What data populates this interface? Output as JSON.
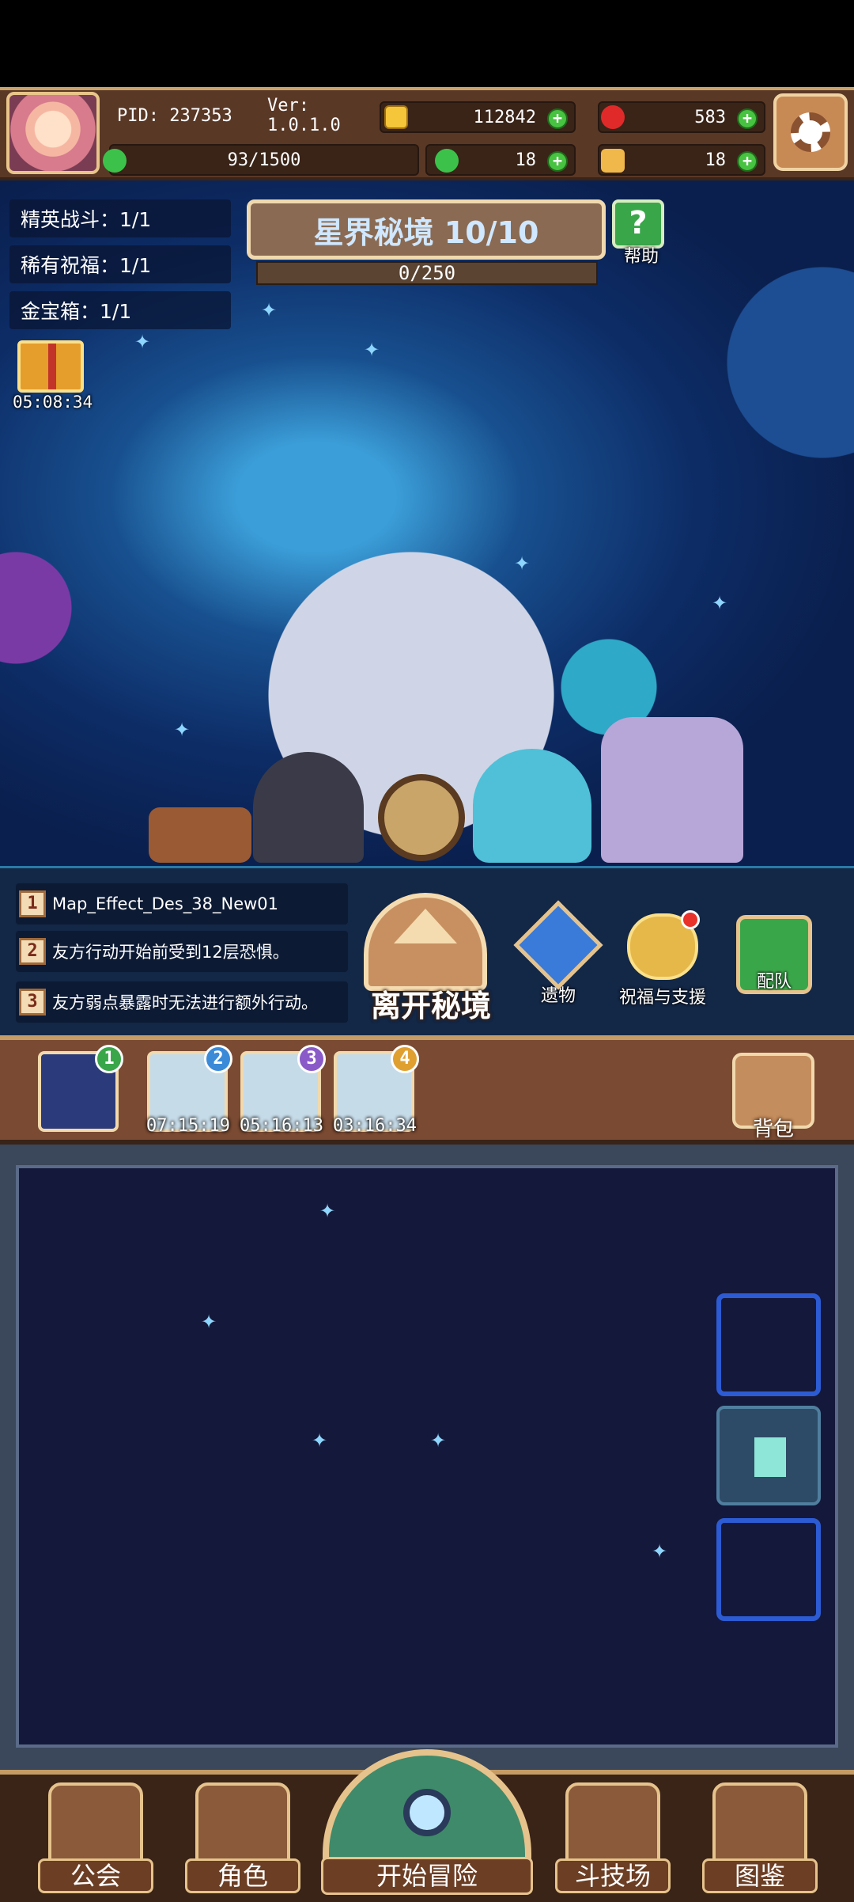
{
  "hud": {
    "pid": "PID: 237353",
    "version": "Ver: 1.0.1.0",
    "gold": "112842",
    "gems": "583",
    "stamina": "93/1500",
    "clover": "18",
    "keys": "18",
    "colors": {
      "plus": "#48c241",
      "gold": "#f5c53a",
      "gem": "#e02a2a",
      "clover": "#3cc24a",
      "key": "#f0b84a"
    }
  },
  "map": {
    "title": "星界秘境 10/10",
    "progress": "0/250",
    "help_label": "帮助"
  },
  "quests": [
    {
      "label": "精英战斗：1/1"
    },
    {
      "label": "稀有祝福：1/1"
    },
    {
      "label": "金宝箱：1/1"
    }
  ],
  "gift": {
    "timer": "05:08:34",
    "icon": "gift-box-icon"
  },
  "effects": [
    {
      "num": "1",
      "text": "Map_Effect_Des_38_New01"
    },
    {
      "num": "2",
      "text": "友方行动开始前受到12层恐惧。"
    },
    {
      "num": "3",
      "text": "友方弱点暴露时无法进行额外行动。"
    }
  ],
  "actions": {
    "leave": "离开秘境",
    "relics": "遗物",
    "blessing": "祝福与支援",
    "team": "配队"
  },
  "relic_slots": [
    {
      "badge": "1",
      "timer": "",
      "badge_color": "#3aa64a"
    },
    {
      "badge": "2",
      "timer": "07:15:19",
      "badge_color": "#3a8ad8"
    },
    {
      "badge": "3",
      "timer": "05:16:13",
      "badge_color": "#8a5ac8"
    },
    {
      "badge": "4",
      "timer": "03:16:34",
      "badge_color": "#e0a030"
    }
  ],
  "bag_label": "背包",
  "nav": {
    "guild": "公会",
    "character": "角色",
    "start": "开始冒险",
    "arena": "斗技场",
    "codex": "图鉴"
  }
}
